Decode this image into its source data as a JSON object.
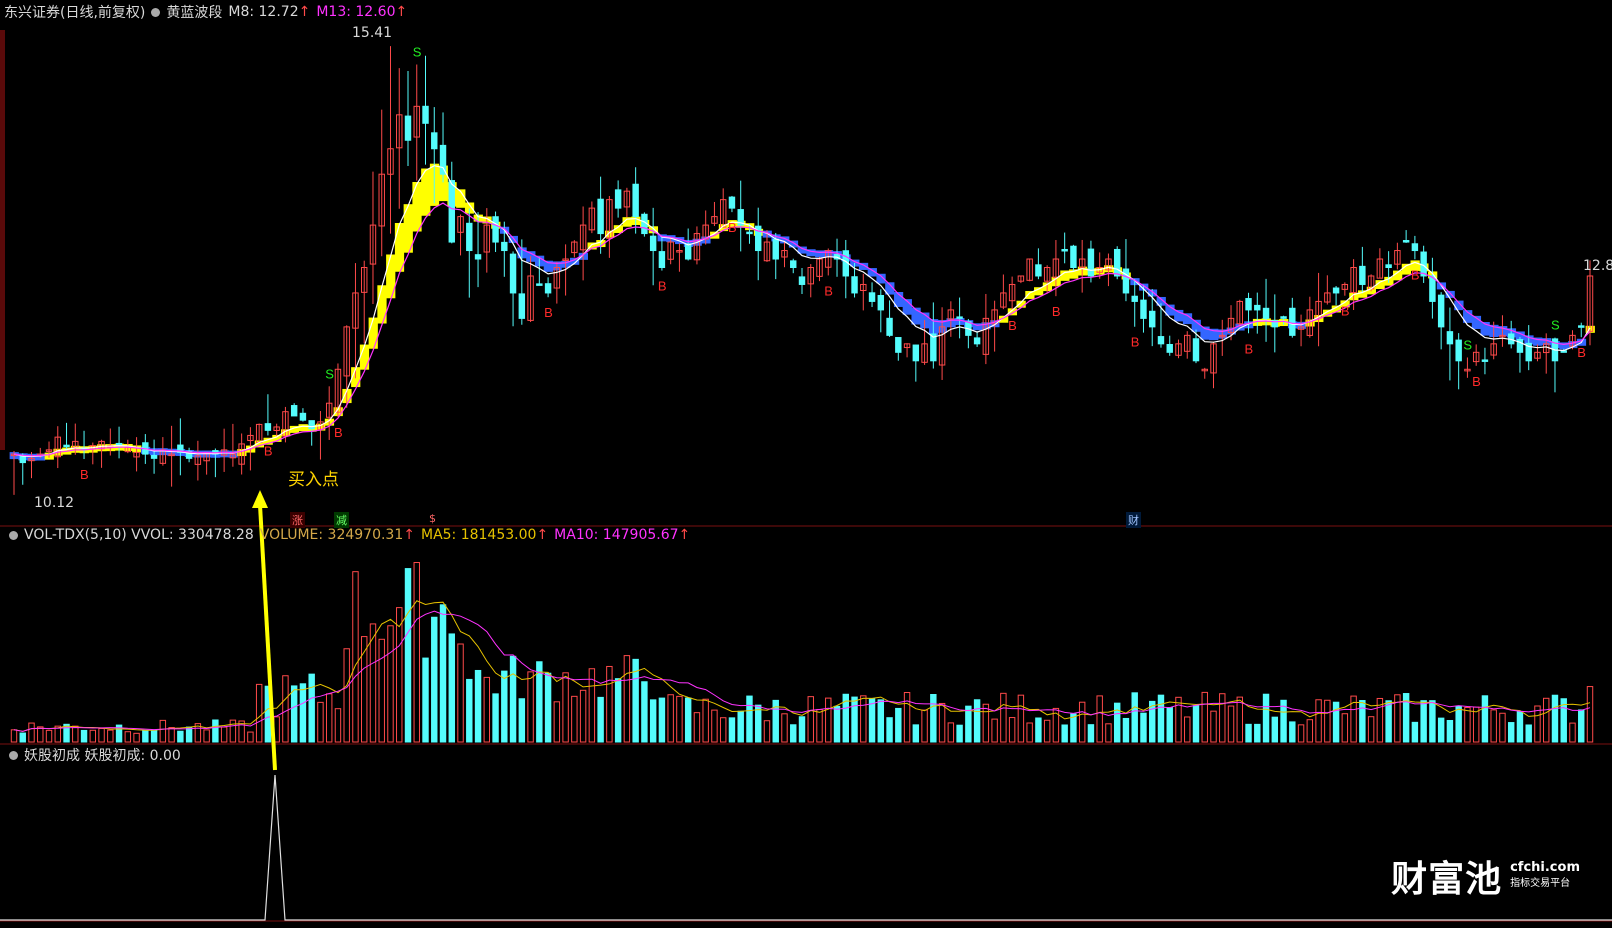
{
  "panels": {
    "price": {
      "security": "东兴证券(日线,前复权)",
      "indicator": "黄蓝波段",
      "m8_label": "M8: 12.72",
      "m13_label": "M13: 12.60",
      "high_label": "15.41",
      "low_label": "10.12",
      "right_label": "12.8",
      "buy_point_label": "买入点",
      "events": [
        "涨",
        "减",
        "$",
        "财"
      ]
    },
    "volume": {
      "title": "VOL-TDX(5,10) VVOL: 330478.28",
      "volume_label": "VOLUME: 324970.31",
      "ma5_label": "MA5: 181453.00",
      "ma10_label": "MA10: 147905.67"
    },
    "indicator": {
      "title": "妖股初成 妖股初成: 0.00"
    }
  },
  "watermark": {
    "brand": "财富池",
    "domain": "cfchi.com",
    "tagline": "指标交易平台"
  },
  "colors": {
    "up": "#ff4a4a",
    "down": "#54fcfc",
    "band_yellow": "#ffff00",
    "band_blue": "#3366ff",
    "m8": "#ffffff",
    "m13": "#ff33ff",
    "ma5": "#e6c200",
    "ma10": "#ff33ff"
  },
  "chart_data": {
    "type": "candlestick",
    "ylim": [
      10.0,
      15.6
    ],
    "closes": [
      10.6,
      10.5,
      10.55,
      10.6,
      10.65,
      10.8,
      10.7,
      10.75,
      10.65,
      10.7,
      10.75,
      10.7,
      10.72,
      10.68,
      10.62,
      10.6,
      10.55,
      10.65,
      10.6,
      10.62,
      10.55,
      10.58,
      10.62,
      10.6,
      10.65,
      10.6,
      10.72,
      10.82,
      10.95,
      10.88,
      10.92,
      11.1,
      11.05,
      11.0,
      10.9,
      10.98,
      11.2,
      11.6,
      12.1,
      12.5,
      12.8,
      13.3,
      13.9,
      14.2,
      14.6,
      14.3,
      14.7,
      14.5,
      14.2,
      13.9,
      13.1,
      13.4,
      13.0,
      12.9,
      13.3,
      13.1,
      13.0,
      12.5,
      12.2,
      12.7,
      12.6,
      12.5,
      12.8,
      12.9,
      13.1,
      13.3,
      13.5,
      13.2,
      13.6,
      13.5,
      13.7,
      13.4,
      13.2,
      13.0,
      12.8,
      13.1,
      13.0,
      12.9,
      13.2,
      13.3,
      13.4,
      13.6,
      13.5,
      13.3,
      13.2,
      13.0,
      13.1,
      12.9,
      13.0,
      12.8,
      12.6,
      12.8,
      12.9,
      13.0,
      12.9,
      12.7,
      12.5,
      12.6,
      12.4,
      12.3,
      12.0,
      11.8,
      11.9,
      11.7,
      11.9,
      11.7,
      12.1,
      12.3,
      12.2,
      12.0,
      11.9,
      12.2,
      12.3,
      12.5,
      12.6,
      12.7,
      12.9,
      12.7,
      12.8,
      12.9,
      13.0,
      12.8,
      12.9,
      12.7,
      12.8,
      12.9,
      12.7,
      12.5,
      12.4,
      12.2,
      12.1,
      11.9,
      11.8,
      11.9,
      12.0,
      11.7,
      11.6,
      11.9,
      12.0,
      12.2,
      12.4,
      12.3,
      12.3,
      12.2,
      12.1,
      12.2,
      12.0,
      12.1,
      12.3,
      12.4,
      12.5,
      12.5,
      12.6,
      12.8,
      12.6,
      12.7,
      12.9,
      12.8,
      13.0,
      13.1,
      13.0,
      12.7,
      12.4,
      12.1,
      11.9,
      11.7,
      11.6,
      11.8,
      11.7,
      11.9,
      12.0,
      11.9,
      11.8,
      11.7,
      11.8,
      11.9,
      11.7,
      11.8,
      12.0,
      12.1,
      12.7
    ],
    "volume_ylim": [
      0,
      350000
    ],
    "volume_pattern": "low ~25000 until breakout; peak ~330000; tapering to ~60000-120000",
    "indicator_spike": 1.0
  }
}
